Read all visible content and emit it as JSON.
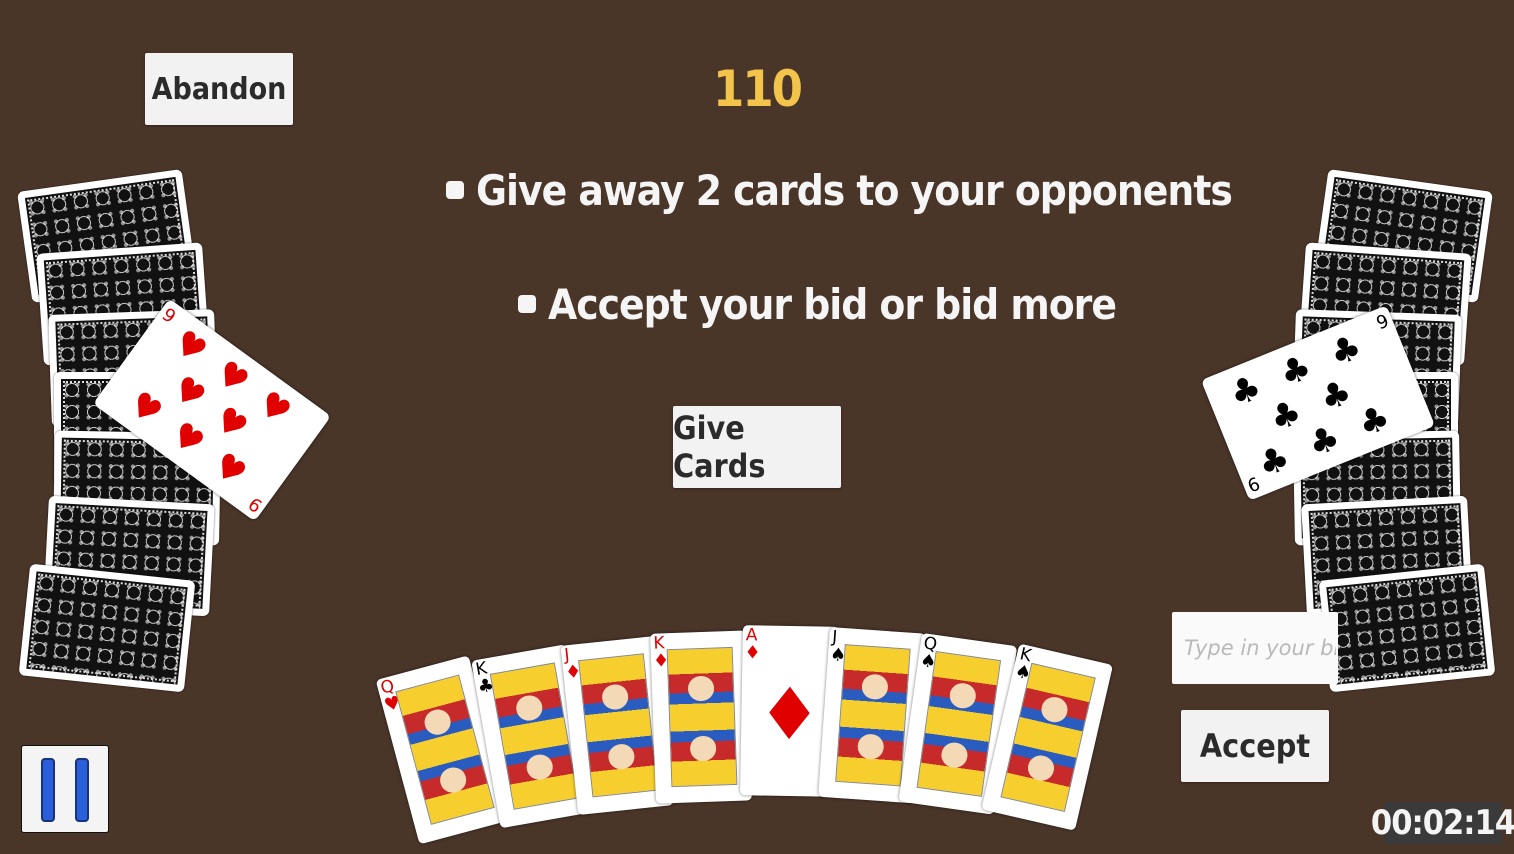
{
  "buttons": {
    "abandon": "Abandon",
    "give_cards": "Give Cards",
    "accept": "Accept"
  },
  "score": "110",
  "instructions": [
    "Give away 2 cards to your opponents",
    "Accept your bid or bid more"
  ],
  "bid_input": {
    "value": "",
    "placeholder": "Type in your bid"
  },
  "timer": "00:02:14",
  "played_cards": {
    "left": {
      "rank": "9",
      "suit": "♥"
    },
    "right": {
      "rank": "9",
      "suit": "♣"
    }
  },
  "hand": [
    {
      "rank": "Q",
      "suit": "♥"
    },
    {
      "rank": "K",
      "suit": "♣"
    },
    {
      "rank": "J",
      "suit": "♦"
    },
    {
      "rank": "K",
      "suit": "♦"
    },
    {
      "rank": "A",
      "suit": "♦"
    },
    {
      "rank": "J",
      "suit": "♠"
    },
    {
      "rank": "Q",
      "suit": "♠"
    },
    {
      "rank": "K",
      "suit": "♠"
    }
  ],
  "icons": {
    "pause": "pause-icon"
  },
  "colors": {
    "table": "#4a3529",
    "score": "#f2c44c",
    "pause": "#2b5fd9"
  }
}
